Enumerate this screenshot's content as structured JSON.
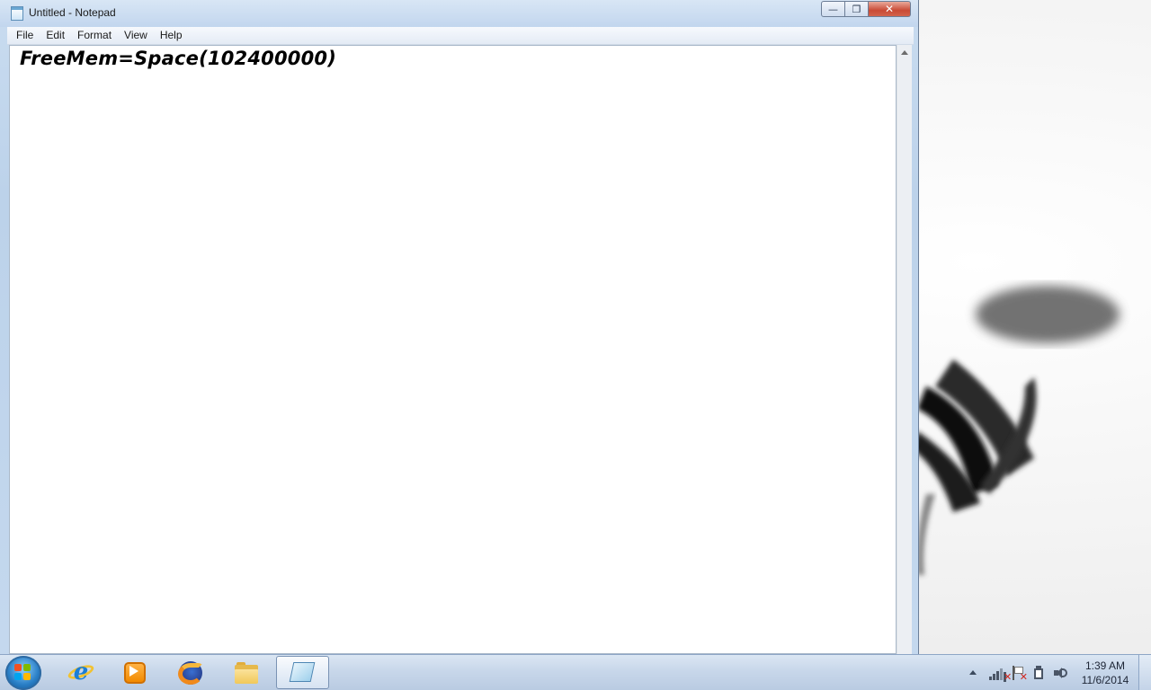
{
  "window": {
    "title": "Untitled - Notepad",
    "caption": {
      "minimize": "—",
      "maximize": "❐",
      "close": "✕"
    }
  },
  "menu": {
    "file": "File",
    "edit": "Edit",
    "format": "Format",
    "view": "View",
    "help": "Help"
  },
  "editor": {
    "content": "FreeMem=Space(102400000)"
  },
  "taskbar": {
    "pinned": [
      "internet-explorer-icon",
      "windows-media-player-icon",
      "firefox-icon",
      "windows-explorer-icon",
      "notepad-icon"
    ],
    "active": "notepad-icon"
  },
  "tray": {
    "icons": [
      "network-icon",
      "action-center-flag-icon",
      "power-icon",
      "volume-icon"
    ],
    "time": "1:39 AM",
    "date": "11/6/2014"
  }
}
